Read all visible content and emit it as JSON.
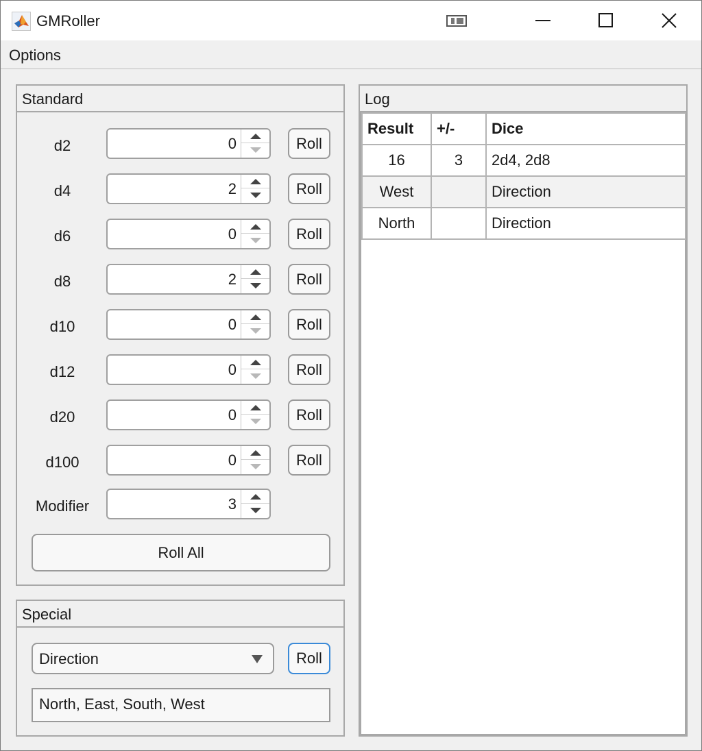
{
  "window": {
    "title": "GMRoller"
  },
  "menu": {
    "options": "Options"
  },
  "standard": {
    "title": "Standard",
    "dice": [
      {
        "label": "d2",
        "value": "0",
        "roll": "Roll"
      },
      {
        "label": "d4",
        "value": "2",
        "roll": "Roll"
      },
      {
        "label": "d6",
        "value": "0",
        "roll": "Roll"
      },
      {
        "label": "d8",
        "value": "2",
        "roll": "Roll"
      },
      {
        "label": "d10",
        "value": "0",
        "roll": "Roll"
      },
      {
        "label": "d12",
        "value": "0",
        "roll": "Roll"
      },
      {
        "label": "d20",
        "value": "0",
        "roll": "Roll"
      },
      {
        "label": "d100",
        "value": "0",
        "roll": "Roll"
      }
    ],
    "modifier": {
      "label": "Modifier",
      "value": "3"
    },
    "roll_all": "Roll All"
  },
  "special": {
    "title": "Special",
    "selected": "Direction",
    "roll": "Roll",
    "options_text": "North, East, South, West"
  },
  "log": {
    "title": "Log",
    "headers": [
      "Result",
      "+/-",
      "Dice"
    ],
    "rows": [
      [
        "16",
        "3",
        "2d4, 2d8"
      ],
      [
        "West",
        "",
        "Direction"
      ],
      [
        "North",
        "",
        "Direction"
      ]
    ]
  },
  "colors": {
    "focus_border": "#3a8ad8",
    "arrow_disabled": "#b8b8b8",
    "arrow_enabled": "#444444"
  }
}
